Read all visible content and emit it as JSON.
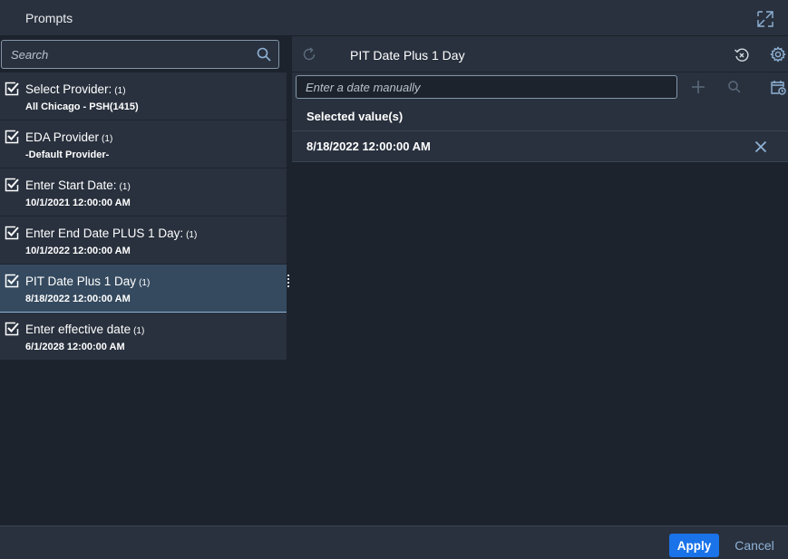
{
  "header": {
    "title": "Prompts",
    "expand_icon": "expand-icon"
  },
  "left": {
    "search": {
      "placeholder": "Search",
      "value": ""
    },
    "prompts": [
      {
        "label": "Select Provider:",
        "count": "(1)",
        "value": "All Chicago - PSH(1415)",
        "checked": true
      },
      {
        "label": "EDA Provider",
        "count": "(1)",
        "value": "-Default Provider-",
        "checked": true
      },
      {
        "label": "Enter Start Date:",
        "count": "(1)",
        "value": "10/1/2021 12:00:00 AM",
        "checked": true
      },
      {
        "label": "Enter End Date PLUS 1 Day:",
        "count": "(1)",
        "value": "10/1/2022 12:00:00 AM",
        "checked": true
      },
      {
        "label": "PIT Date Plus 1 Day",
        "count": "(1)",
        "value": "8/18/2022 12:00:00 AM",
        "checked": true,
        "selected": true
      },
      {
        "label": "Enter effective date",
        "count": "(1)",
        "value": "6/1/2028 12:00:00 AM",
        "checked": true
      }
    ]
  },
  "right": {
    "title": "PIT Date Plus 1 Day",
    "date_input": {
      "placeholder": "Enter a date manually",
      "value": ""
    },
    "selected_header": "Selected value(s)",
    "selected_values": [
      "8/18/2022 12:00:00 AM"
    ]
  },
  "footer": {
    "apply_label": "Apply",
    "cancel_label": "Cancel"
  },
  "colors": {
    "background": "#1d232d",
    "panel": "#29313e",
    "selected_item": "#354a5f",
    "accent": "#1a73e8",
    "link": "#8fb2d6"
  }
}
